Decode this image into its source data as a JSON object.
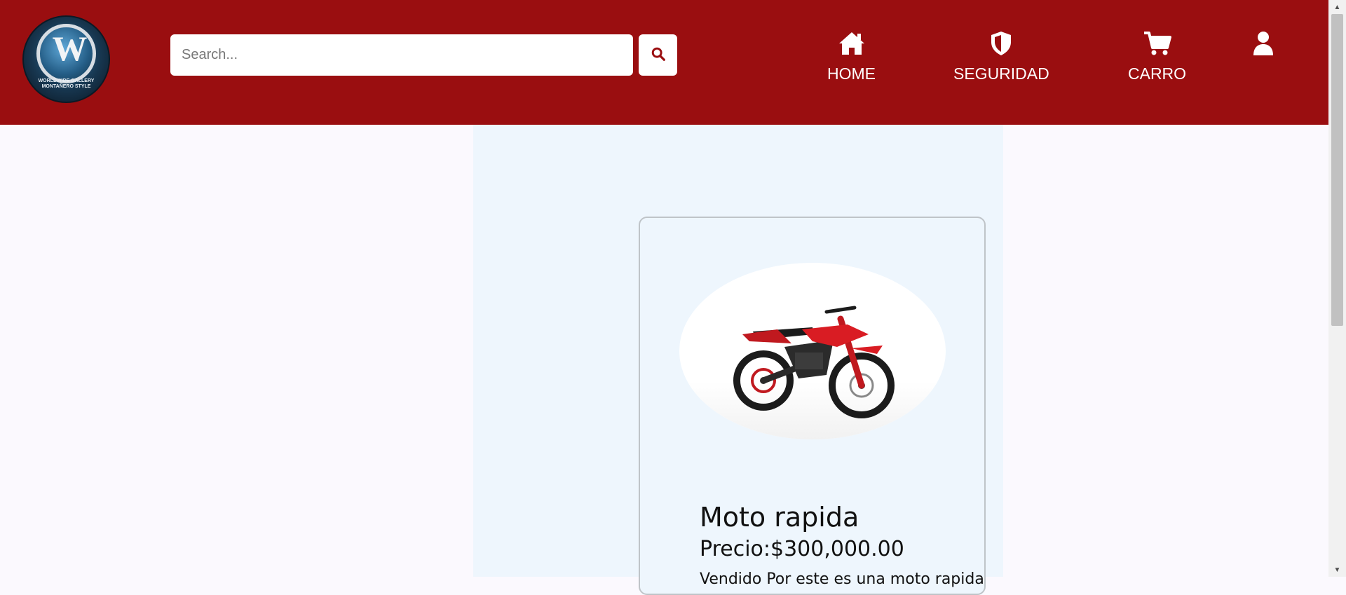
{
  "header": {
    "logo_text": "WORLDWIDE GALLERY MONTAÑERO STYLE",
    "logo_letter": "W",
    "background_color": "#9a0e10"
  },
  "search": {
    "placeholder": "Search...",
    "value": "",
    "button_icon": "search-icon"
  },
  "nav": {
    "items": [
      {
        "label": "HOME",
        "icon": "home-icon"
      },
      {
        "label": "SEGURIDAD",
        "icon": "shield-icon"
      },
      {
        "label": "CARRO",
        "icon": "cart-icon"
      },
      {
        "label": "",
        "icon": "user-icon"
      }
    ]
  },
  "product": {
    "title": "Moto rapida",
    "price": "Precio:$300,000.00",
    "description": "Vendido Por este es una moto rapida",
    "image": "motorcycle-image"
  },
  "colors": {
    "accent": "#9a0e10",
    "page_bg": "#fbf9fe",
    "content_bg": "#eef6fd"
  }
}
